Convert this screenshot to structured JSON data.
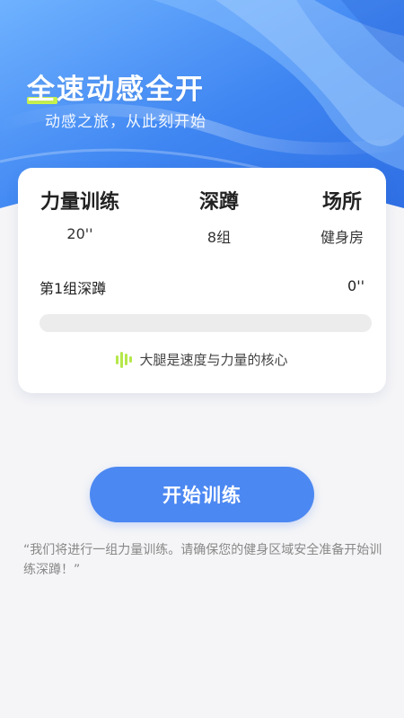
{
  "hero": {
    "title": "全速动感全开",
    "subtitle": "动感之旅，从此刻开始"
  },
  "card": {
    "stats": [
      {
        "title": "力量训练",
        "value": "20''"
      },
      {
        "title": "深蹲",
        "value": "8组"
      },
      {
        "title": "场所",
        "value": "健身房"
      }
    ],
    "current_group_label": "第1组深蹲",
    "current_group_time": "0''",
    "progress_fraction": 0,
    "tip_text": "大腿是速度与力量的核心"
  },
  "start_button_label": "开始训练",
  "note": "“我们将进行一组力量训练。请确保您的健身区域安全准备开始训练深蹲！”",
  "colors": {
    "hero_blue": "#4a8ef5",
    "accent_green": "#c6f24e",
    "button_blue": "#4c88f2",
    "background": "#f5f5f7"
  },
  "icons": {
    "tip_icon": "sound-wave-icon"
  }
}
